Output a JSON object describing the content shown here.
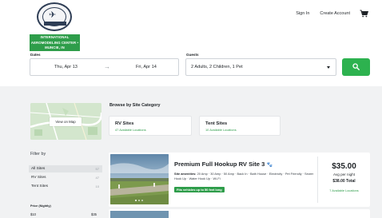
{
  "brand": {
    "name": "INTERNATIONAL AEROMODELING CENTER • MUNCIE, IN",
    "seal_text": "ACADEMY OF MODEL AERONAUTICS"
  },
  "nav": {
    "sign_in": "Sign In",
    "create_account": "Create Account",
    "cart_icon": "cart-icon"
  },
  "search": {
    "dates_label": "Dates",
    "check_in": "Thu, Apr 13",
    "check_out": "Fri, Apr 14",
    "guests_label": "Guests",
    "guests_value": "2 Adults, 2 Children, 1 Pet",
    "search_icon": "search-icon"
  },
  "map": {
    "view_on_map": "View on Map"
  },
  "browse": {
    "title": "Browse by Site Category",
    "categories": [
      {
        "name": "RV Sites",
        "sub": "47 Available Locations"
      },
      {
        "name": "Tent Sites",
        "sub": "10 Available Locations"
      }
    ]
  },
  "filters": {
    "title": "Filter by",
    "items": [
      {
        "label": "All Sites",
        "count": "57",
        "selected": true
      },
      {
        "label": "RV Sites",
        "count": "47",
        "selected": false
      },
      {
        "label": "Tent Sites",
        "count": "10",
        "selected": false
      }
    ],
    "price_label": "Price (Nightly)",
    "price_min": "$10",
    "price_max": "$35"
  },
  "listing": {
    "title": "Premium Full Hookup RV Site 3",
    "amenities_label": "Site amenities:",
    "amenities": "20 Amp · 30 Amp · 50 Amp · Back In · Bath House · Electricity · Pet Friendly · Sewer Hook Up · Water Hook Up · Wi-Fi",
    "badge": "Fits vehicles up to 50 feet long",
    "price": "$35.00",
    "avg_label": "Avg per night",
    "total": "$38.00 Total",
    "locations": "7 Available Locations",
    "paw_icon": "paw-icon"
  },
  "colors": {
    "accent_green": "#2db24f",
    "badge_green": "#2e9d4a",
    "body_grey": "#f1f2f3"
  }
}
